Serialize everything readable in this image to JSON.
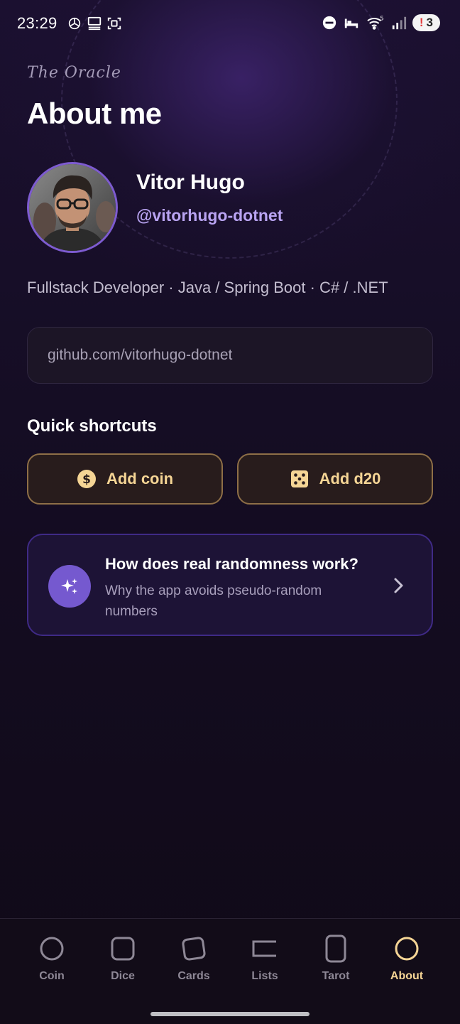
{
  "status_bar": {
    "time": "23:29",
    "battery_level": "3",
    "left_icons": [
      "openai-icon",
      "desktop-icon",
      "screen-capture-icon"
    ],
    "right_icons": [
      "do-not-disturb-icon",
      "bed-icon",
      "wifi-icon",
      "signal-icon",
      "battery-icon"
    ]
  },
  "header": {
    "brand": "The Oracle",
    "title": "About me"
  },
  "profile": {
    "name": "Vitor Hugo",
    "handle": "@vitorhugo-dotnet",
    "bio": "Fullstack Developer · Java / Spring Boot · C# / .NET",
    "link": "github.com/vitorhugo-dotnet"
  },
  "shortcuts": {
    "title": "Quick shortcuts",
    "add_coin": "Add coin",
    "add_d20": "Add d20"
  },
  "info_card": {
    "title": "How does real randomness work?",
    "subtitle": "Why the app avoids pseudo-random numbers"
  },
  "nav": {
    "items": [
      {
        "label": "Coin",
        "icon": "circle-icon"
      },
      {
        "label": "Dice",
        "icon": "square-icon"
      },
      {
        "label": "Cards",
        "icon": "card-icon"
      },
      {
        "label": "Lists",
        "icon": "list-icon"
      },
      {
        "label": "Tarot",
        "icon": "tarot-card-icon"
      },
      {
        "label": "About",
        "icon": "about-circle-icon"
      }
    ],
    "active": "About"
  },
  "colors": {
    "accent_gold": "#f5d595",
    "accent_purple": "#7559cf",
    "handle_purple": "#b9a4f2",
    "background": "#120b1c"
  }
}
